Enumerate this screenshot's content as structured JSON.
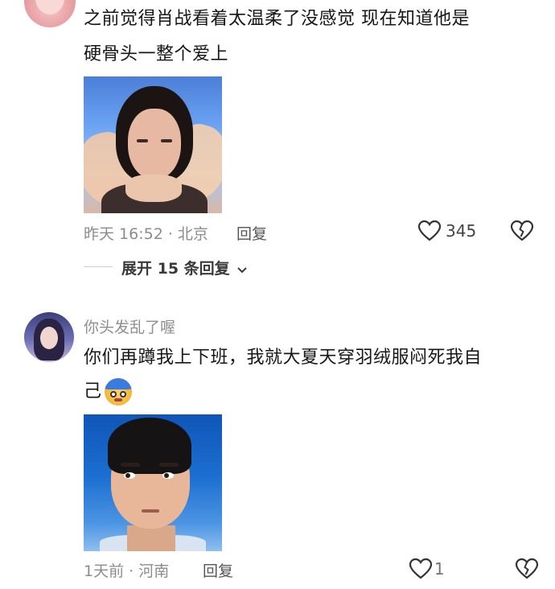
{
  "comments": [
    {
      "text_line1": "之前觉得肖战看着太温柔了没感觉 现在知道他是",
      "text_line2": "硬骨头一整个爱上",
      "time": "昨天 16:52",
      "location": "北京",
      "reply_label": "回复",
      "likes": "345",
      "expand_label": "展开 15 条回复"
    },
    {
      "username": "你头发乱了喔",
      "text_line1": "你们再蹲我上下班，我就大夏天穿羽绒服闷死我自",
      "text_line2": "己",
      "time": "1天前",
      "location": "河南",
      "reply_label": "回复",
      "likes": "1"
    }
  ],
  "icons": {
    "like": "heart-outline-icon",
    "dislike": "broken-heart-icon",
    "expand": "chevron-down-icon",
    "emoji": "sweating-emoji-icon"
  },
  "colors": {
    "text": "#161616",
    "meta": "#8c8c8c",
    "reply": "#555555"
  }
}
